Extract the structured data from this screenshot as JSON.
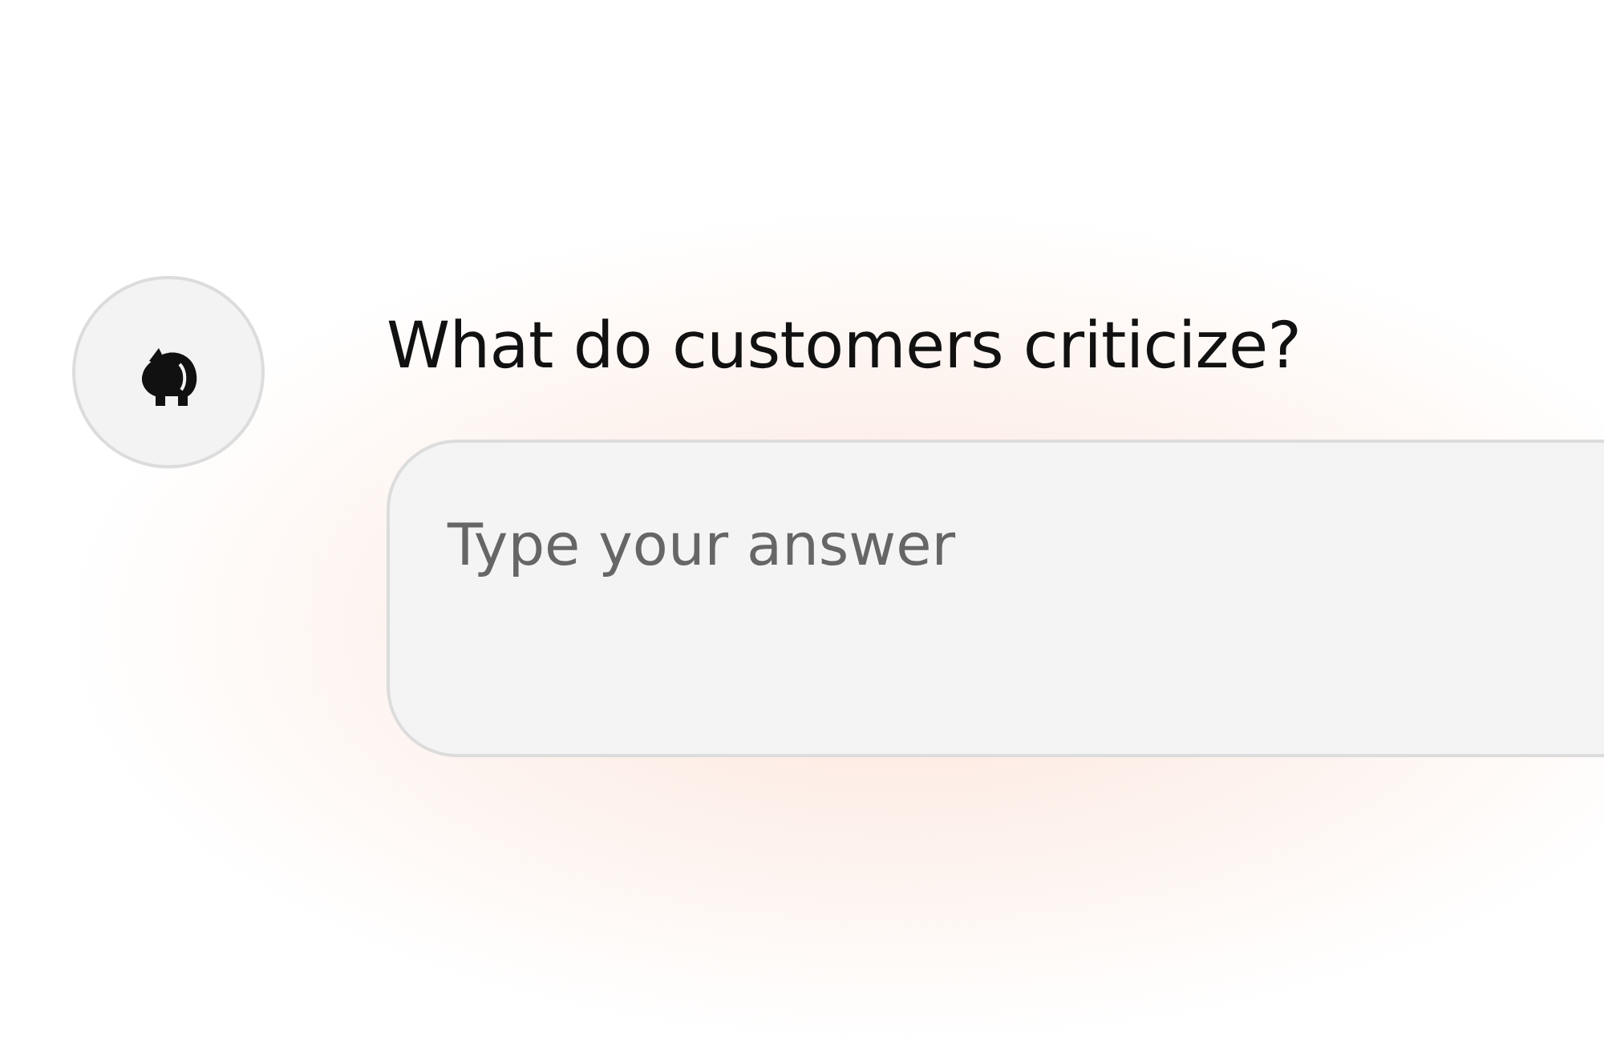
{
  "question": "What do customers criticize?",
  "answer": {
    "placeholder": "Type your answer"
  }
}
